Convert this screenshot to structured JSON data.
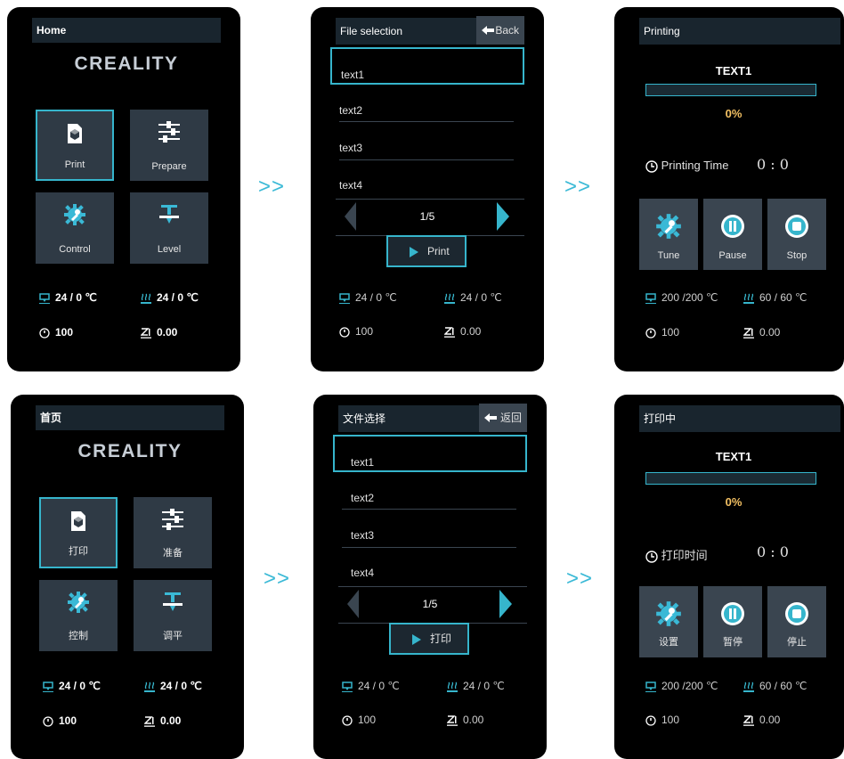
{
  "arrow": ">>",
  "colors": {
    "accent": "#36b5cc",
    "percent": "#f2c063",
    "tile": "#2f3a45"
  },
  "en": {
    "home": {
      "title": "Home",
      "logo": "CREALITY",
      "tiles": [
        {
          "label": "Print",
          "icon": "print-cube-icon"
        },
        {
          "label": "Prepare",
          "icon": "sliders-icon"
        },
        {
          "label": "Control",
          "icon": "gear-wrench-icon"
        },
        {
          "label": "Level",
          "icon": "level-bed-icon"
        }
      ],
      "nozzle_temp": "24 / 0 ℃",
      "bed_temp": "24 / 0 ℃",
      "speed": "100",
      "z": "0.00"
    },
    "files": {
      "title": "File selection",
      "back": "Back",
      "items": [
        "text1",
        "text2",
        "text3",
        "text4"
      ],
      "page": "1/5",
      "print": "Print",
      "nozzle_temp": "24 /  0 ℃",
      "bed_temp": "24 /  0 ℃",
      "speed": "100",
      "z": "0.00"
    },
    "printing": {
      "title": "Printing",
      "file": "TEXT1",
      "progress": 0,
      "percent": "0%",
      "time_label": "Printing Time",
      "time_value": "0 : 0",
      "controls": [
        {
          "label": "Tune",
          "icon": "gear-wrench-icon"
        },
        {
          "label": "Pause",
          "icon": "pause-icon"
        },
        {
          "label": "Stop",
          "icon": "stop-icon"
        }
      ],
      "nozzle_temp": "200 /200  ℃",
      "bed_temp": "60 / 60   ℃",
      "speed": "100",
      "z": "0.00"
    }
  },
  "zh": {
    "home": {
      "title": "首页",
      "logo": "CREALITY",
      "tiles": [
        {
          "label": "打印",
          "icon": "print-cube-icon"
        },
        {
          "label": "准备",
          "icon": "sliders-icon"
        },
        {
          "label": "控制",
          "icon": "gear-wrench-icon"
        },
        {
          "label": "调平",
          "icon": "level-bed-icon"
        }
      ],
      "nozzle_temp": "24 / 0 ℃",
      "bed_temp": "24 / 0 ℃",
      "speed": "100",
      "z": "0.00"
    },
    "files": {
      "title": "文件选择",
      "back": "返回",
      "items": [
        "text1",
        "text2",
        "text3",
        "text4"
      ],
      "page": "1/5",
      "print": "打印",
      "nozzle_temp": "24 /  0 ℃",
      "bed_temp": "24 /  0 ℃",
      "speed": "100",
      "z": "0.00"
    },
    "printing": {
      "title": "打印中",
      "file": "TEXT1",
      "progress": 0,
      "percent": "0%",
      "time_label": "打印时间",
      "time_value": "0 : 0",
      "controls": [
        {
          "label": "设置",
          "icon": "gear-wrench-icon"
        },
        {
          "label": "暂停",
          "icon": "pause-icon"
        },
        {
          "label": "停止",
          "icon": "stop-icon"
        }
      ],
      "nozzle_temp": "200 /200  ℃",
      "bed_temp": "60 / 60   ℃",
      "speed": "100",
      "z": "0.00"
    }
  }
}
